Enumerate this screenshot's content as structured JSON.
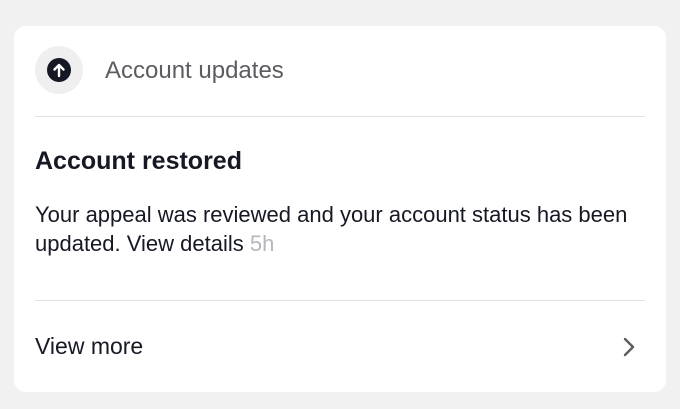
{
  "header": {
    "icon": "arrow-up-circle-icon",
    "title": "Account updates"
  },
  "notification": {
    "title": "Account restored",
    "body": "Your appeal was reviewed and your account status has been updated. View details",
    "timestamp": "5h"
  },
  "footer": {
    "label": "View more",
    "icon": "chevron-right-icon"
  }
}
